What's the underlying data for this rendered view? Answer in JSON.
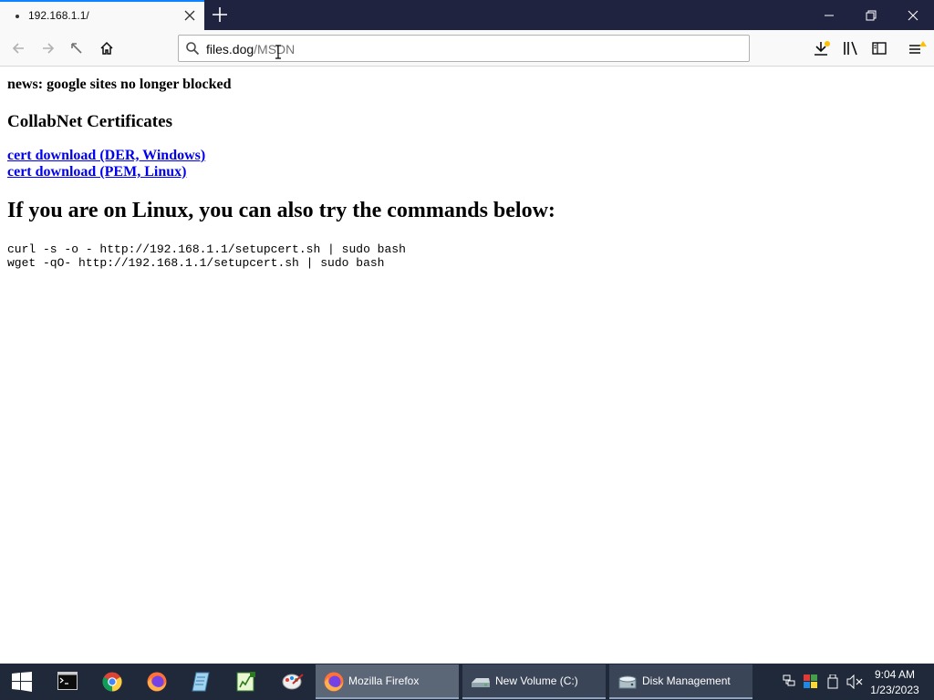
{
  "browser": {
    "tab_title": "192.168.1.1/",
    "url_host": "files.dog",
    "url_path": "/MSDN"
  },
  "page": {
    "news": "news: google sites no longer blocked",
    "cert_heading": "CollabNet Certificates",
    "links": [
      "cert download (DER, Windows)",
      "cert download (PEM, Linux)"
    ],
    "linux_heading": "If you are on Linux, you can also try the commands below:",
    "commands": [
      "curl -s -o - http://192.168.1.1/setupcert.sh | sudo bash",
      "wget -qO- http://192.168.1.1/setupcert.sh | sudo bash"
    ]
  },
  "taskbar": {
    "tasks": [
      "Mozilla Firefox",
      "New Volume (C:)",
      "Disk Management"
    ],
    "time": "9:04 AM",
    "date": "1/23/2023"
  },
  "colors": {
    "tabbar": "#202340",
    "taskbar": "#1f2939",
    "link": "#0000ee",
    "tab_accent": "#0a84ff"
  }
}
